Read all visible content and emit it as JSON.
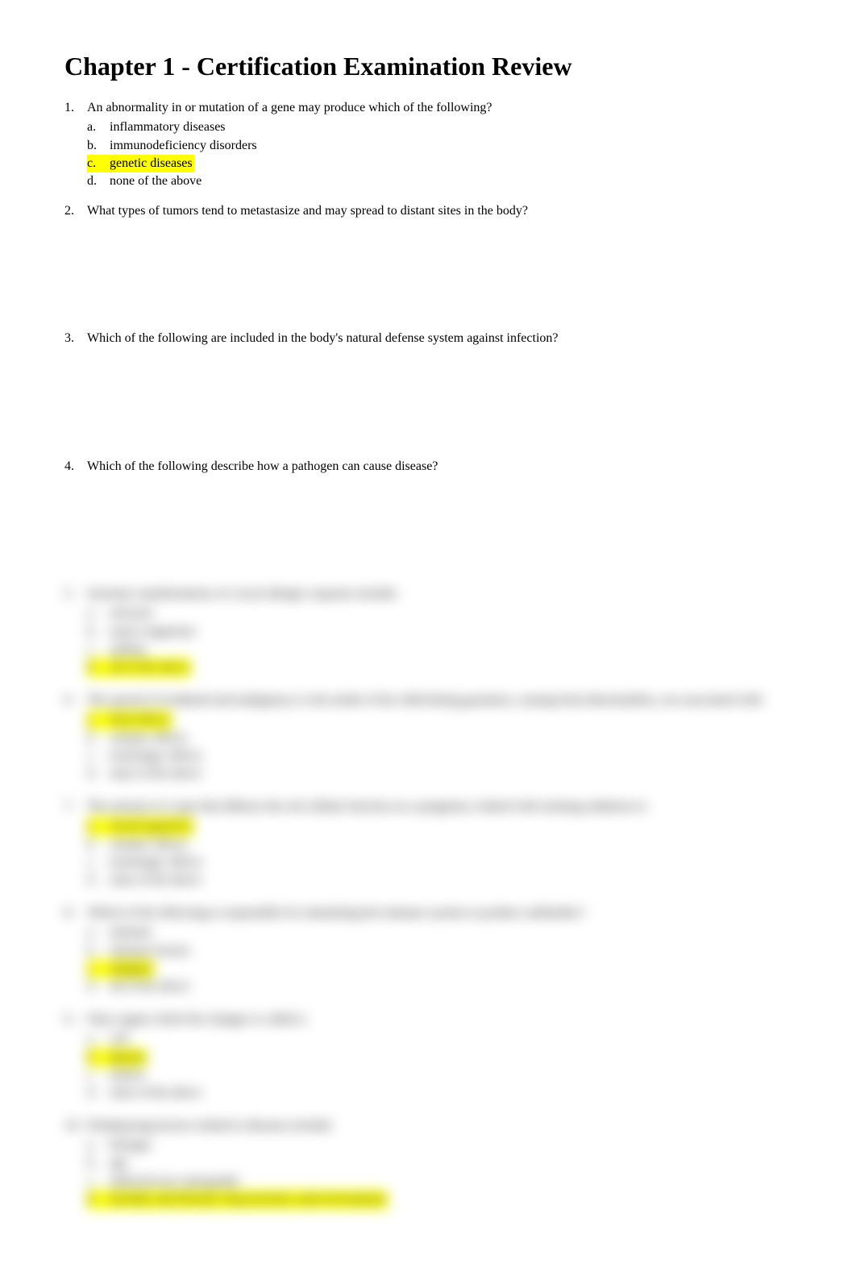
{
  "title": "Chapter 1 - Certification Examination Review",
  "questions": [
    {
      "text": "An abnormality in or mutation of a gene may produce which of the following?",
      "options": [
        {
          "text": "inflammatory diseases",
          "highlight": false
        },
        {
          "text": "immunodeficiency disorders",
          "highlight": false
        },
        {
          "text": "genetic diseases",
          "highlight": true
        },
        {
          "text": "none of the above",
          "highlight": false
        }
      ],
      "spacer": false
    },
    {
      "text": "What types of tumors tend to metastasize and may spread to distant sites in the body?",
      "options": [],
      "spacer": true
    },
    {
      "text": "Which of the following are included in the body's natural defense system against infection?",
      "options": [],
      "spacer": true
    },
    {
      "text": "Which of the following describe how a pathogen can cause disease?",
      "options": [],
      "spacer": true
    }
  ],
  "blurred_questions": [
    {
      "text": "Systemic manifestations of a local allergic response include:",
      "options": [
        {
          "text": "urticaria",
          "highlight": false
        },
        {
          "text": "nasal congestion",
          "highlight": false
        },
        {
          "text": "asthma",
          "highlight": false
        },
        {
          "text": "all of the above",
          "highlight": true
        }
      ]
    },
    {
      "text": "The spread of irradiated and malignancy to the inside of the child during gestation, causing fetal abnormalities, are associated with:",
      "options": [
        {
          "text": "fetal effects",
          "highlight": true
        },
        {
          "text": "somatic effects",
          "highlight": false
        },
        {
          "text": "teratologic effects",
          "highlight": false
        },
        {
          "text": "none of the above",
          "highlight": false
        }
      ]
    },
    {
      "text": "The amount of a type that diffuses the red cellular function on a pregnancy related with ionizing radiation to:",
      "options": [
        {
          "text": "teratol (genetic)",
          "highlight": true
        },
        {
          "text": "somatic effects",
          "highlight": false
        },
        {
          "text": "teratologic effects",
          "highlight": false
        },
        {
          "text": "none of the above",
          "highlight": false
        }
      ]
    },
    {
      "text": "Which of the following is responsible for stimulating the immune system to produce antibodies?",
      "options": [
        {
          "text": "immune",
          "highlight": false
        },
        {
          "text": "immune factors",
          "highlight": false
        },
        {
          "text": "antigens",
          "highlight": true
        },
        {
          "text": "all of the above",
          "highlight": false
        }
      ]
    },
    {
      "text": "Fatty organs which the changes is called a:",
      "options": [
        {
          "text": "cell",
          "highlight": false
        },
        {
          "text": "lipoma",
          "highlight": true
        },
        {
          "text": "tumors",
          "highlight": false
        },
        {
          "text": "none of the above",
          "highlight": false
        }
      ]
    },
    {
      "text": "Predisposing factors related to diseases include:",
      "options": [
        {
          "text": "biologic",
          "highlight": false
        },
        {
          "text": "age",
          "highlight": false
        },
        {
          "text": "ethnicity/race and gender",
          "highlight": false
        },
        {
          "text": "heredity and lifestyle characteristics and environment",
          "highlight": true
        }
      ]
    }
  ]
}
